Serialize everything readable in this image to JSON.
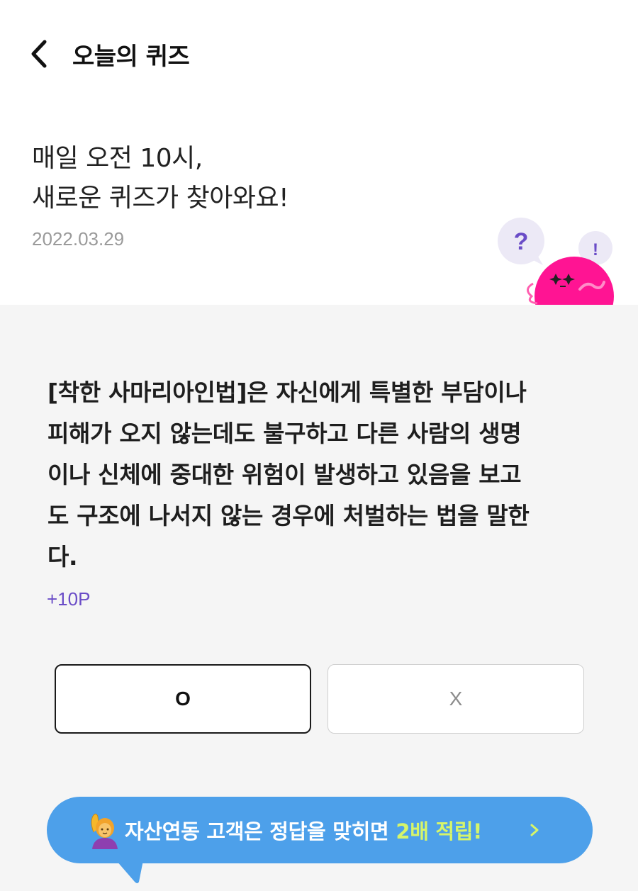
{
  "header": {
    "title": "오늘의 퀴즈",
    "back_icon": "chevron-left-icon"
  },
  "intro": {
    "line1": "매일 오전 10시,",
    "line2": "새로운 퀴즈가 찾아와요!",
    "date": "2022.03.29",
    "bubble_question": "?",
    "bubble_exclaim": "!"
  },
  "quiz": {
    "question_lines": [
      "[착한 사마리아인법]은 자신에게 특별한 부담이나",
      "피해가 오지 않는데도 불구하고 다른 사람의 생명",
      "이나 신체에 중대한 위험이 발생하고 있음을 보고",
      "도 구조에 나서지 않는 경우에 처벌하는 법을 말한",
      "다."
    ],
    "points": "+10P",
    "answer_o": "O",
    "answer_x": "X"
  },
  "banner": {
    "text": "자산연동 고객은 정답을 맞히면",
    "highlight": "2배 적립!",
    "emoji_icon": "raising-hand-emoji-icon",
    "chevron_icon": "chevron-right-icon"
  },
  "colors": {
    "points": "#6a4cc7",
    "banner_bg": "#4da0ea",
    "banner_highlight": "#d6f56a",
    "character": "#ff1493",
    "bubble": "#ece9f6"
  }
}
